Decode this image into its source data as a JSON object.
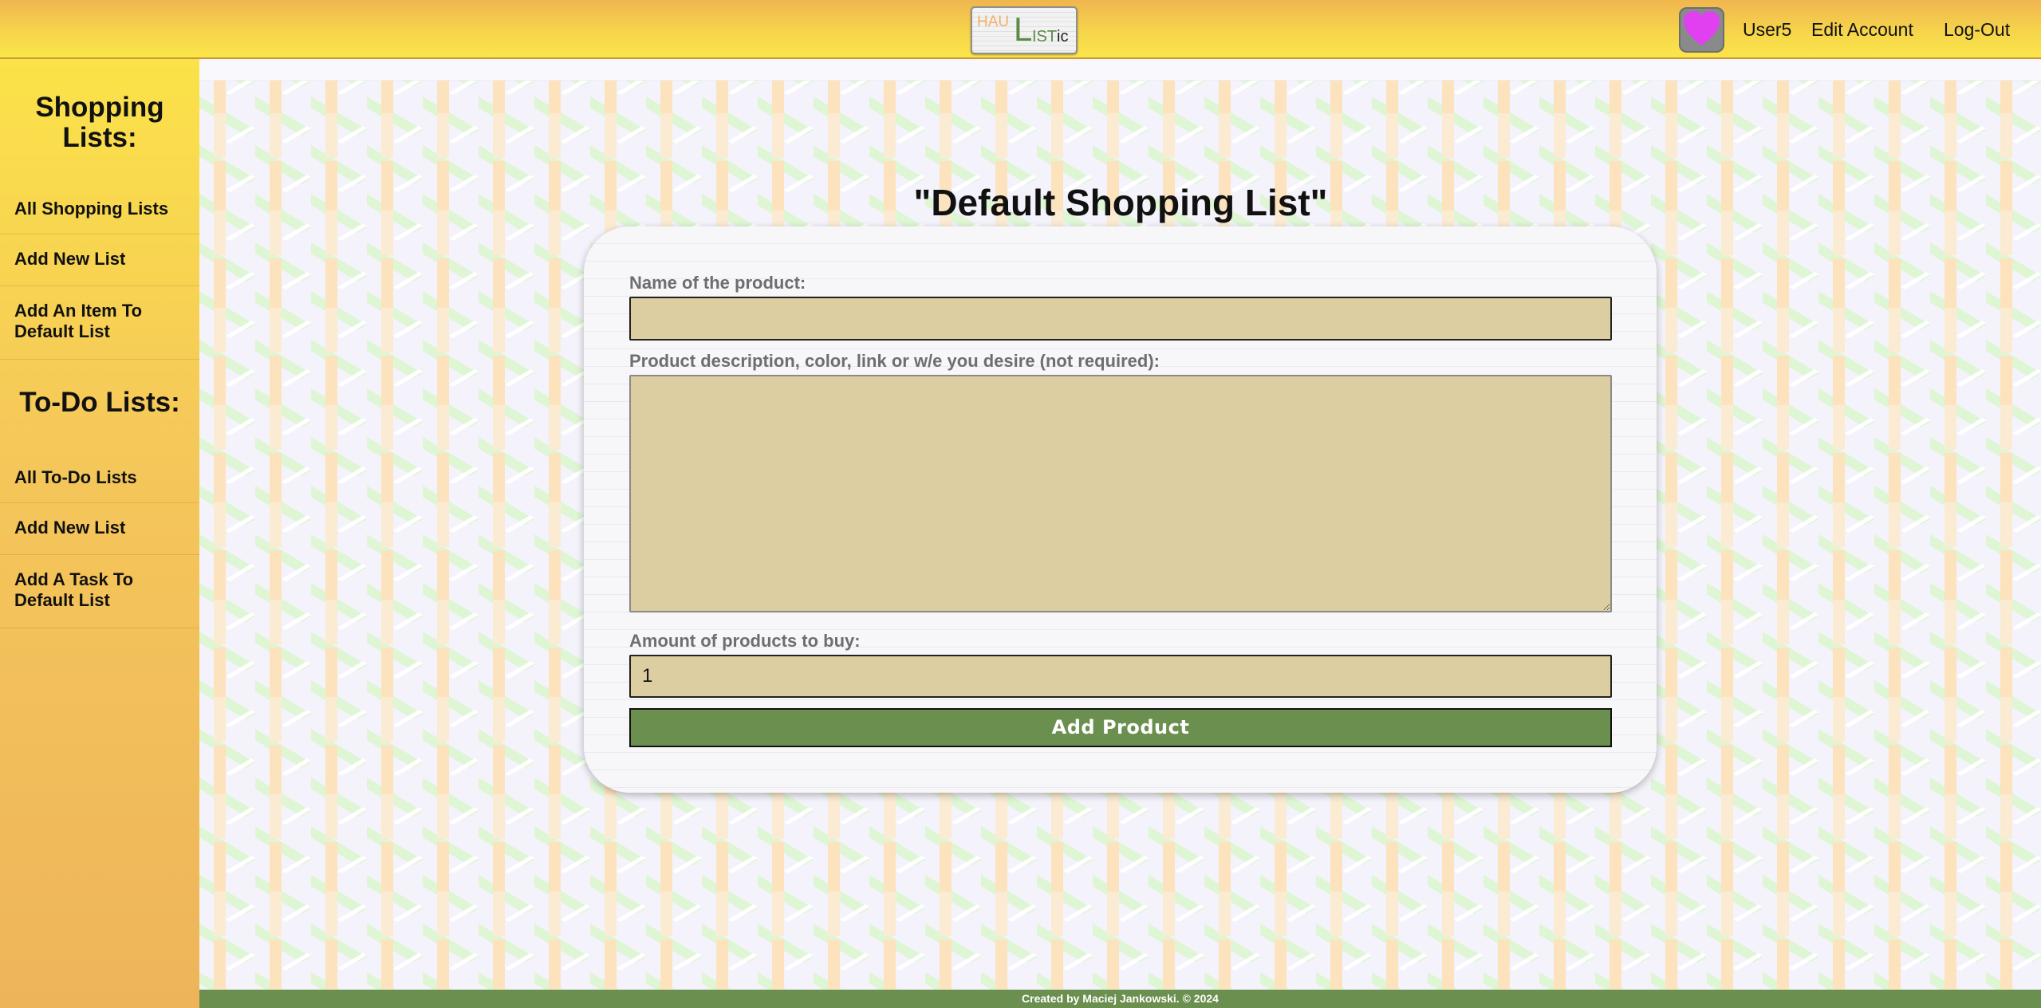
{
  "header": {
    "logo": {
      "part1": "HAU",
      "part2": "L",
      "part3": "IST",
      "part4": "ic"
    },
    "username": "User5",
    "edit_account": "Edit Account",
    "logout": "Log-Out",
    "avatar_icon": "heart-icon",
    "avatar_color": "#e040f0"
  },
  "sidebar": {
    "shopping_heading": "Shopping Lists:",
    "shopping_items": [
      "All Shopping Lists",
      "Add New List",
      "Add An Item To Default List"
    ],
    "todo_heading": "To-Do Lists:",
    "todo_items": [
      "All To-Do Lists",
      "Add New List",
      "Add A Task To Default List"
    ]
  },
  "main": {
    "title": "\"Default Shopping List\"",
    "form": {
      "name_label": "Name of the product:",
      "name_value": "",
      "description_label": "Product description, color, link or w/e you desire (not required):",
      "description_value": "",
      "amount_label": "Amount of products to buy:",
      "amount_value": "1",
      "submit_label": "Add Product"
    }
  },
  "footer": {
    "text": "Created by Maciej Jankowski. © 2024"
  },
  "colors": {
    "header_gradient_top": "#f0b64f",
    "header_gradient_bottom": "#fbe64a",
    "input_bg": "#dccea0",
    "button_green": "#6a8f4f",
    "pattern_green": "#dff7d6",
    "pattern_orange": "#fde2bc",
    "pattern_white": "#ffffff"
  }
}
